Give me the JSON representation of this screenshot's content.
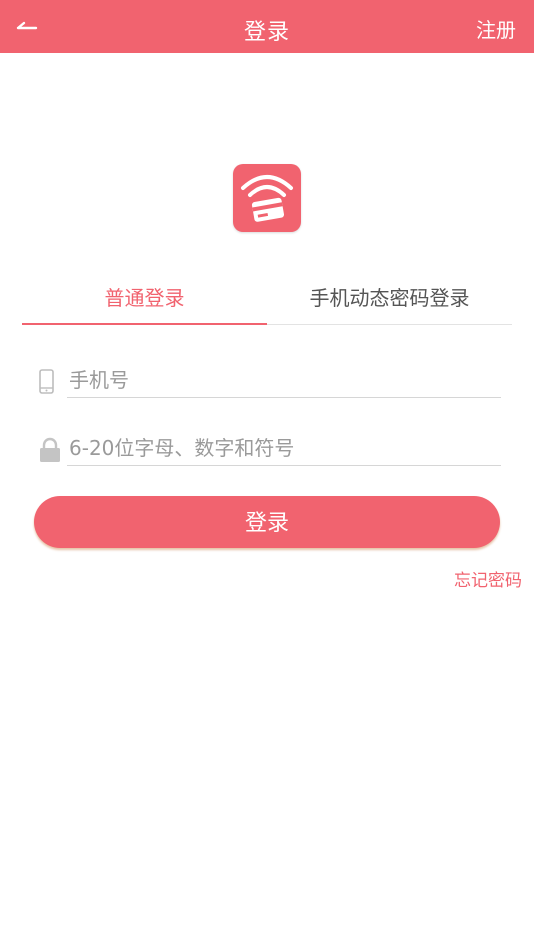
{
  "header": {
    "title": "登录",
    "register_label": "注册"
  },
  "tabs": [
    {
      "label": "普通登录",
      "active": true
    },
    {
      "label": "手机动态密码登录",
      "active": false
    }
  ],
  "form": {
    "phone": {
      "placeholder": "手机号",
      "value": ""
    },
    "password": {
      "placeholder": "6-20位字母、数字和符号",
      "value": ""
    }
  },
  "login_button_label": "登录",
  "forgot_password_label": "忘记密码",
  "colors": {
    "accent": "#f1636f",
    "text_muted": "#9a9a9a",
    "divider": "#d6d6d6"
  },
  "icons": {
    "back": "arrow-left-icon",
    "logo": "wifi-card-logo-icon",
    "phone": "mobile-phone-icon",
    "password": "lock-icon"
  }
}
